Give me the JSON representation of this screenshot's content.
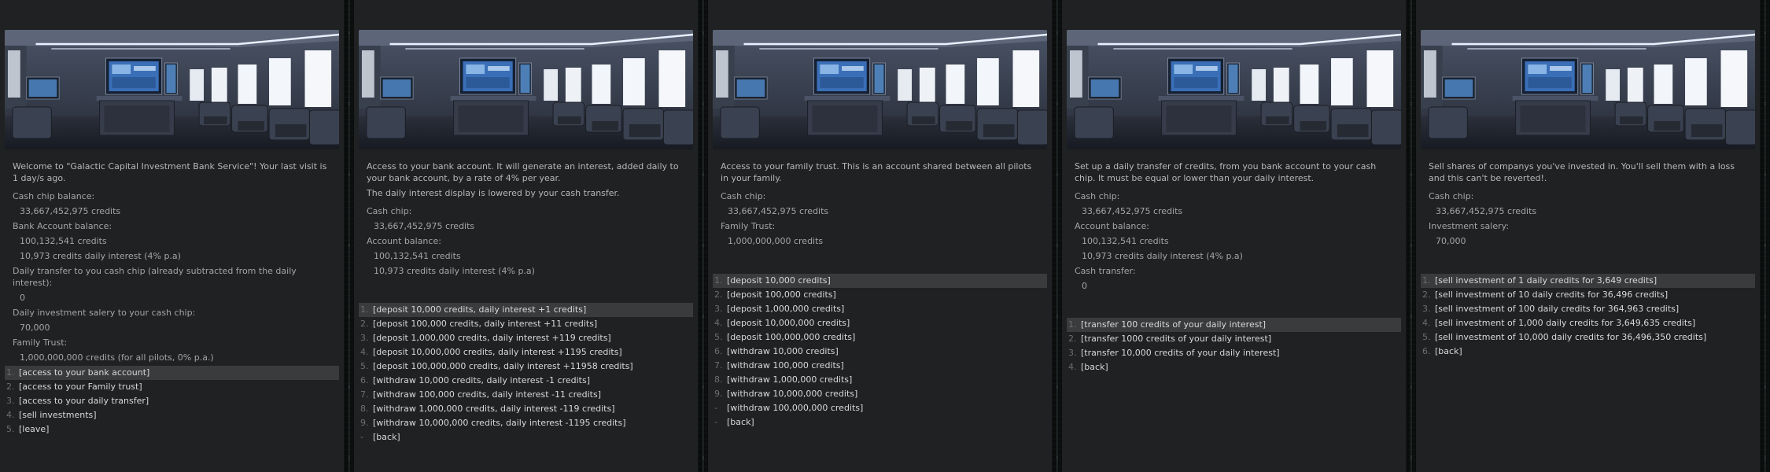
{
  "panels": [
    {
      "key": "main",
      "intro": [
        "Welcome to \"Galactic Capital Investment Bank Service\"! Your last visit is 1 day/s ago."
      ],
      "fields": [
        {
          "label": "Cash chip balance:",
          "values": [
            "33,667,452,975 credits"
          ]
        },
        {
          "label": "Bank Account balance:",
          "values": [
            "100,132,541 credits",
            "10,973 credits daily interest (4% p.a)"
          ]
        },
        {
          "label": "Daily transfer to you cash chip (already subtracted from the daily interest):",
          "values": [
            "0"
          ]
        },
        {
          "label": "Daily investment salery to your cash chip:",
          "values": [
            "70,000"
          ]
        },
        {
          "label": "Family Trust:",
          "values": [
            "1,000,000,000 credits (for all pilots, 0% p.a.)"
          ]
        }
      ],
      "menu": [
        {
          "num": "1.",
          "label": "[access to your bank account]",
          "selected": true
        },
        {
          "num": "2.",
          "label": "[access to your Family trust]"
        },
        {
          "num": "3.",
          "label": "[access to your daily transfer]"
        },
        {
          "num": "4.",
          "label": "[sell investments]"
        },
        {
          "num": "5.",
          "label": "[leave]"
        }
      ]
    },
    {
      "key": "bank-account",
      "intro": [
        "Access to your bank account. It will generate an interest, added daily to your bank account, by a rate of 4% per year.",
        "The daily interest display is lowered by your cash transfer."
      ],
      "fields": [
        {
          "label": "Cash chip:",
          "values": [
            "33,667,452,975 credits"
          ]
        },
        {
          "label": "Account balance:",
          "values": [
            "100,132,541 credits",
            "10,973 credits daily interest (4% p.a)"
          ]
        }
      ],
      "menu": [
        {
          "num": "1.",
          "label": "[deposit 10,000 credits, daily interest +1 credits]",
          "selected": true
        },
        {
          "num": "2.",
          "label": "[deposit 100,000 credits, daily interest +11 credits]"
        },
        {
          "num": "3.",
          "label": "[deposit 1,000,000 credits, daily interest +119 credits]"
        },
        {
          "num": "4.",
          "label": "[deposit 10,000,000 credits, daily interest +1195 credits]"
        },
        {
          "num": "5.",
          "label": "[deposit 100,000,000 credits, daily interest +11958 credits]"
        },
        {
          "num": "6.",
          "label": "[withdraw 10,000 credits, daily interest -1 credits]"
        },
        {
          "num": "7.",
          "label": "[withdraw 100,000 credits, daily interest -11 credits]"
        },
        {
          "num": "8.",
          "label": "[withdraw 1,000,000 credits, daily interest -119 credits]"
        },
        {
          "num": "9.",
          "label": "[withdraw 10,000,000 credits, daily interest -1195 credits]"
        },
        {
          "num": "-",
          "label": "[back]"
        }
      ]
    },
    {
      "key": "family-trust",
      "intro": [
        "Access to your family trust. This is an account shared between all pilots in your family."
      ],
      "fields": [
        {
          "label": "Cash chip:",
          "values": [
            "33,667,452,975 credits"
          ]
        },
        {
          "label": "Family Trust:",
          "values": [
            "1,000,000,000 credits"
          ]
        }
      ],
      "menu": [
        {
          "num": "1.",
          "label": "[deposit 10,000 credits]",
          "selected": true
        },
        {
          "num": "2.",
          "label": "[deposit 100,000 credits]"
        },
        {
          "num": "3.",
          "label": "[deposit 1,000,000 credits]"
        },
        {
          "num": "4.",
          "label": "[deposit 10,000,000 credits]"
        },
        {
          "num": "5.",
          "label": "[deposit 100,000,000 credits]"
        },
        {
          "num": "6.",
          "label": "[withdraw 10,000 credits]"
        },
        {
          "num": "7.",
          "label": "[withdraw 100,000 credits]"
        },
        {
          "num": "8.",
          "label": "[withdraw 1,000,000 credits]"
        },
        {
          "num": "9.",
          "label": "[withdraw 10,000,000 credits]"
        },
        {
          "num": "-",
          "label": "[withdraw 100,000,000 credits]"
        },
        {
          "num": "-",
          "label": "[back]"
        }
      ]
    },
    {
      "key": "daily-transfer",
      "intro": [
        "Set up a daily transfer of credits, from you bank account to your cash chip. It must be equal or lower than your daily interest."
      ],
      "fields": [
        {
          "label": "Cash chip:",
          "values": [
            "33,667,452,975 credits"
          ]
        },
        {
          "label": "Account balance:",
          "values": [
            "100,132,541 credits",
            "10,973 credits daily interest (4% p.a)"
          ]
        },
        {
          "label": "Cash transfer:",
          "values": [
            "0"
          ]
        }
      ],
      "menu": [
        {
          "num": "1.",
          "label": "[transfer 100 credits of your daily interest]",
          "selected": true
        },
        {
          "num": "2.",
          "label": "[transfer 1000 credits of your daily interest]"
        },
        {
          "num": "3.",
          "label": "[transfer 10,000 credits of your daily interest]"
        },
        {
          "num": "4.",
          "label": "[back]"
        }
      ]
    },
    {
      "key": "sell-investments",
      "intro": [
        "Sell shares of companys you've invested in. You'll sell them with a loss and this can't be reverted!."
      ],
      "fields": [
        {
          "label": "Cash chip:",
          "values": [
            "33,667,452,975 credits"
          ]
        },
        {
          "label": "Investment salery:",
          "values": [
            "70,000"
          ]
        }
      ],
      "menu": [
        {
          "num": "1.",
          "label": "[sell investment of 1 daily credits for 3,649 credits]",
          "selected": true
        },
        {
          "num": "2.",
          "label": "[sell investment of 10 daily credits for 36,496 credits]"
        },
        {
          "num": "3.",
          "label": "[sell investment of 100 daily credits for 364,963 credits]"
        },
        {
          "num": "4.",
          "label": "[sell investment of 1,000 daily credits for 3,649,635 credits]"
        },
        {
          "num": "5.",
          "label": "[sell investment of 10,000 daily credits for 36,496,350 credits]"
        },
        {
          "num": "6.",
          "label": "[back]"
        }
      ]
    }
  ],
  "colors": {
    "panel_bg": "#202122",
    "selected_row": "#3a3b3c",
    "text": "#b4b8b9",
    "menu_text": "#d6d9da"
  }
}
